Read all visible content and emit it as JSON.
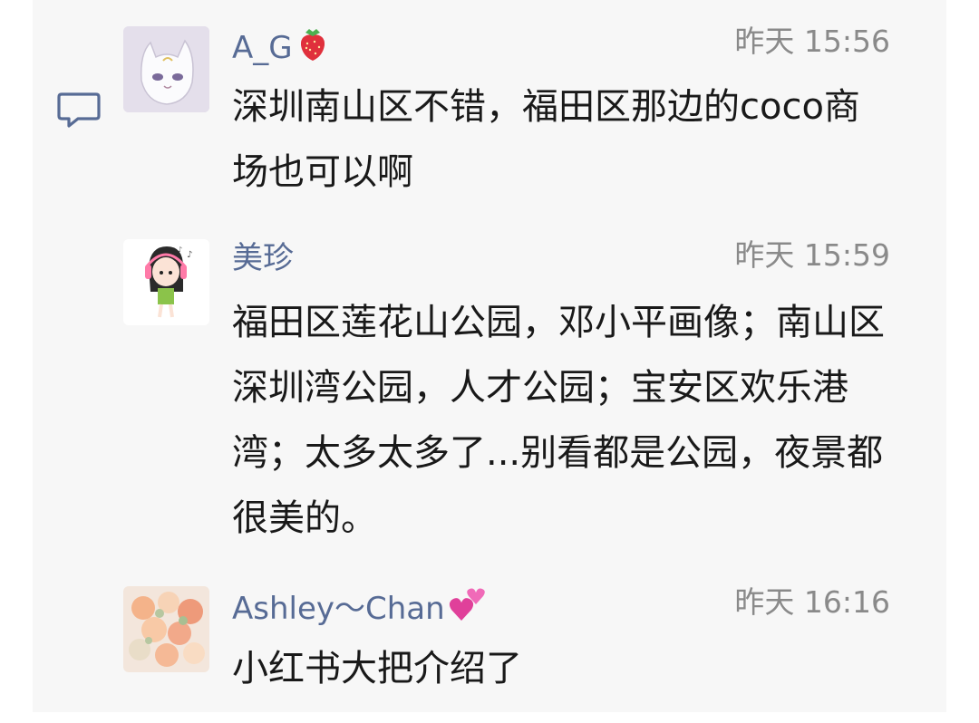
{
  "comments": [
    {
      "username": "A_G",
      "username_emoji": "strawberry-icon",
      "timestamp": "昨天 15:56",
      "text": "深圳南山区不错，福田区那边的coco商场也可以啊",
      "avatar": "white-cat-avatar"
    },
    {
      "username": "美珍",
      "timestamp": "昨天 15:59",
      "text": "福田区莲花山公园，邓小平画像；南山区深圳湾公园，人才公园；宝安区欢乐港湾；太多太多了...别看都是公园，夜景都很美的。",
      "avatar": "cartoon-girl-avatar"
    },
    {
      "username": "Ashley～Chan",
      "username_emoji": "two-hearts-icon",
      "timestamp": "昨天 16:16",
      "text": "小红书大把介绍了",
      "avatar": "flower-bouquet-avatar"
    }
  ],
  "colors": {
    "panel_bg": "#f7f7f7",
    "username": "#576b95",
    "timestamp": "#8a8a8a",
    "text": "#191919"
  }
}
